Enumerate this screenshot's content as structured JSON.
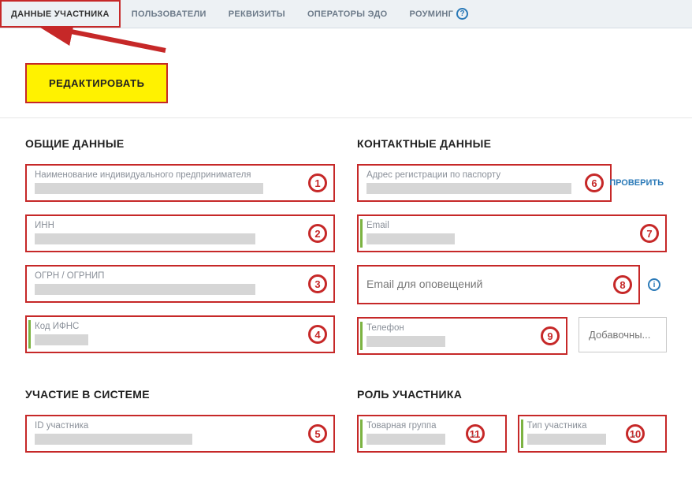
{
  "tabs": {
    "participant": "ДАННЫЕ УЧАСТНИКА",
    "users": "ПОЛЬЗОВАТЕЛИ",
    "requisites": "РЕКВИЗИТЫ",
    "edo": "ОПЕРАТОРЫ ЭДО",
    "roaming": "РОУМИНГ"
  },
  "buttons": {
    "edit": "РЕДАКТИРОВАТЬ",
    "verify": "ПРОВЕРИТЬ"
  },
  "sections": {
    "general": "ОБЩИЕ ДАННЫЕ",
    "contact": "КОНТАКТНЫЕ ДАННЫЕ",
    "system": "УЧАСТИЕ В СИСТЕМЕ",
    "role": "РОЛЬ УЧАСТНИКА"
  },
  "fields": {
    "name": "Наименование индивидуального предпринимателя",
    "inn": "ИНН",
    "ogrn": "ОГРН / ОГРНИП",
    "ifns": "Код ИФНС",
    "part_id": "ID участника",
    "address": "Адрес регистрации по паспорту",
    "email": "Email",
    "email_notif": "Email для оповещений",
    "phone": "Телефон",
    "ext_placeholder": "Добавочны...",
    "group": "Товарная группа",
    "ptype": "Тип участника"
  },
  "badges": {
    "b1": "1",
    "b2": "2",
    "b3": "3",
    "b4": "4",
    "b5": "5",
    "b6": "6",
    "b7": "7",
    "b8": "8",
    "b9": "9",
    "b10": "10",
    "b11": "11"
  }
}
